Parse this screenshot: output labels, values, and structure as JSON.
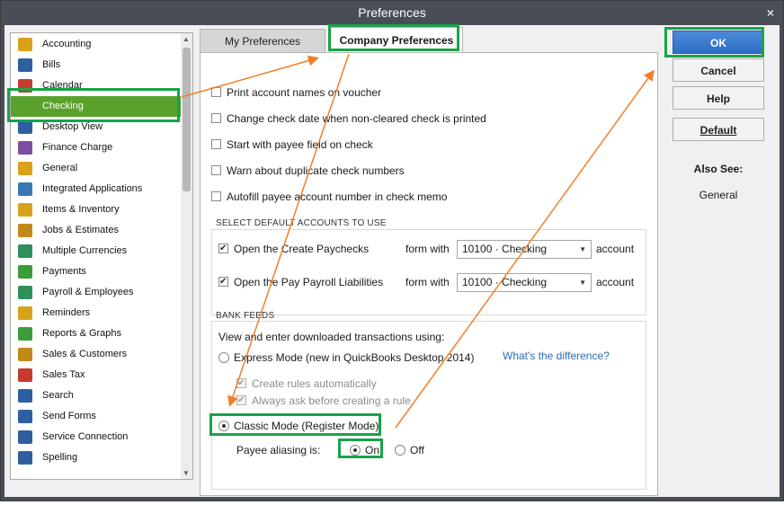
{
  "window": {
    "title": "Preferences",
    "close_glyph": "×"
  },
  "sidebar": {
    "items": [
      {
        "label": "Accounting",
        "icon": "accounting-icon"
      },
      {
        "label": "Bills",
        "icon": "bills-icon"
      },
      {
        "label": "Calendar",
        "icon": "calendar-icon"
      },
      {
        "label": "Checking",
        "icon": "checking-icon",
        "selected": true
      },
      {
        "label": "Desktop View",
        "icon": "desktop-view-icon"
      },
      {
        "label": "Finance Charge",
        "icon": "finance-charge-icon"
      },
      {
        "label": "General",
        "icon": "general-icon"
      },
      {
        "label": "Integrated Applications",
        "icon": "integrated-apps-icon"
      },
      {
        "label": "Items & Inventory",
        "icon": "items-inventory-icon"
      },
      {
        "label": "Jobs & Estimates",
        "icon": "jobs-estimates-icon"
      },
      {
        "label": "Multiple Currencies",
        "icon": "multiple-currencies-icon"
      },
      {
        "label": "Payments",
        "icon": "payments-icon"
      },
      {
        "label": "Payroll & Employees",
        "icon": "payroll-employees-icon"
      },
      {
        "label": "Reminders",
        "icon": "reminders-icon"
      },
      {
        "label": "Reports & Graphs",
        "icon": "reports-graphs-icon"
      },
      {
        "label": "Sales & Customers",
        "icon": "sales-customers-icon"
      },
      {
        "label": "Sales Tax",
        "icon": "sales-tax-icon"
      },
      {
        "label": "Search",
        "icon": "search-icon"
      },
      {
        "label": "Send Forms",
        "icon": "send-forms-icon"
      },
      {
        "label": "Service Connection",
        "icon": "service-connection-icon"
      },
      {
        "label": "Spelling",
        "icon": "spelling-icon"
      }
    ]
  },
  "tabs": {
    "my_preferences": "My Preferences",
    "company_preferences": "Company Preferences"
  },
  "options": {
    "print_account_names": "Print account names on voucher",
    "change_check_date": "Change check date when non-cleared check is printed",
    "start_with_payee": "Start with payee field on check",
    "warn_duplicate": "Warn about duplicate check numbers",
    "autofill_payee": "Autofill payee account number in check memo"
  },
  "default_accounts": {
    "heading": "SELECT DEFAULT ACCOUNTS TO USE",
    "paychecks_label": "Open the Create Paychecks",
    "liabilities_label": "Open the Pay Payroll Liabilities",
    "form_with": "form with",
    "account": "account",
    "paychecks_account": "10100 · Checking",
    "liabilities_account": "10100 · Checking"
  },
  "bank_feeds": {
    "heading": "BANK FEEDS",
    "intro": "View and enter downloaded transactions using:",
    "express_mode": "Express Mode (new in QuickBooks Desktop 2014)",
    "whats_difference": "What's the difference?",
    "create_rules": "Create rules automatically",
    "always_ask": "Always ask before creating a rule",
    "classic_mode": "Classic Mode (Register Mode)",
    "payee_aliasing": "Payee aliasing is:",
    "on": "On",
    "off": "Off"
  },
  "buttons": {
    "ok": "OK",
    "cancel": "Cancel",
    "help": "Help",
    "default": "Default"
  },
  "also_see": {
    "heading": "Also See:",
    "general": "General"
  },
  "colors": {
    "selected": "#5aa12c",
    "highlight": "#18a34a",
    "arrow": "#f07f2a",
    "ok_button": "#2e6ec6",
    "link": "#2a6cb7"
  }
}
